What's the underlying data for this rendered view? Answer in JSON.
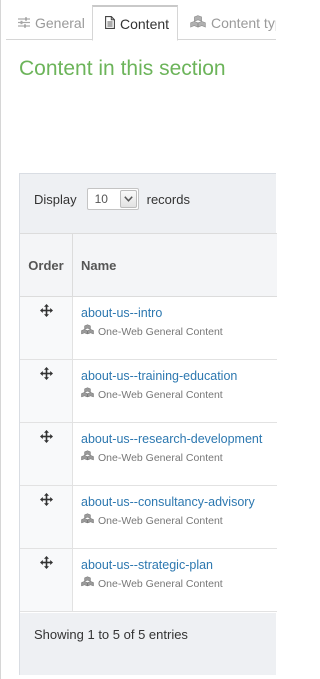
{
  "tabs": [
    {
      "label": "General",
      "icon": "sliders-icon"
    },
    {
      "label": "Content",
      "icon": "document-icon"
    },
    {
      "label": "Content typ",
      "icon": "cubes-icon"
    }
  ],
  "page_title": "Content in this section",
  "display": {
    "prefix": "Display",
    "selected": "10",
    "suffix": "records"
  },
  "table": {
    "headers": {
      "order": "Order",
      "name": "Name"
    },
    "rows": [
      {
        "title": "about-us--intro",
        "type": "One-Web General Content"
      },
      {
        "title": "about-us--training-education",
        "type": "One-Web General Content"
      },
      {
        "title": "about-us--research-development",
        "type": "One-Web General Content"
      },
      {
        "title": "about-us--consultancy-advisory",
        "type": "One-Web General Content"
      },
      {
        "title": "about-us--strategic-plan",
        "type": "One-Web General Content"
      }
    ]
  },
  "footer": {
    "info": "Showing 1 to 5 of 5 entries"
  },
  "colors": {
    "title_green": "#6cb45a",
    "link_blue": "#2d78b0",
    "panel_bg": "#eef0f3"
  }
}
